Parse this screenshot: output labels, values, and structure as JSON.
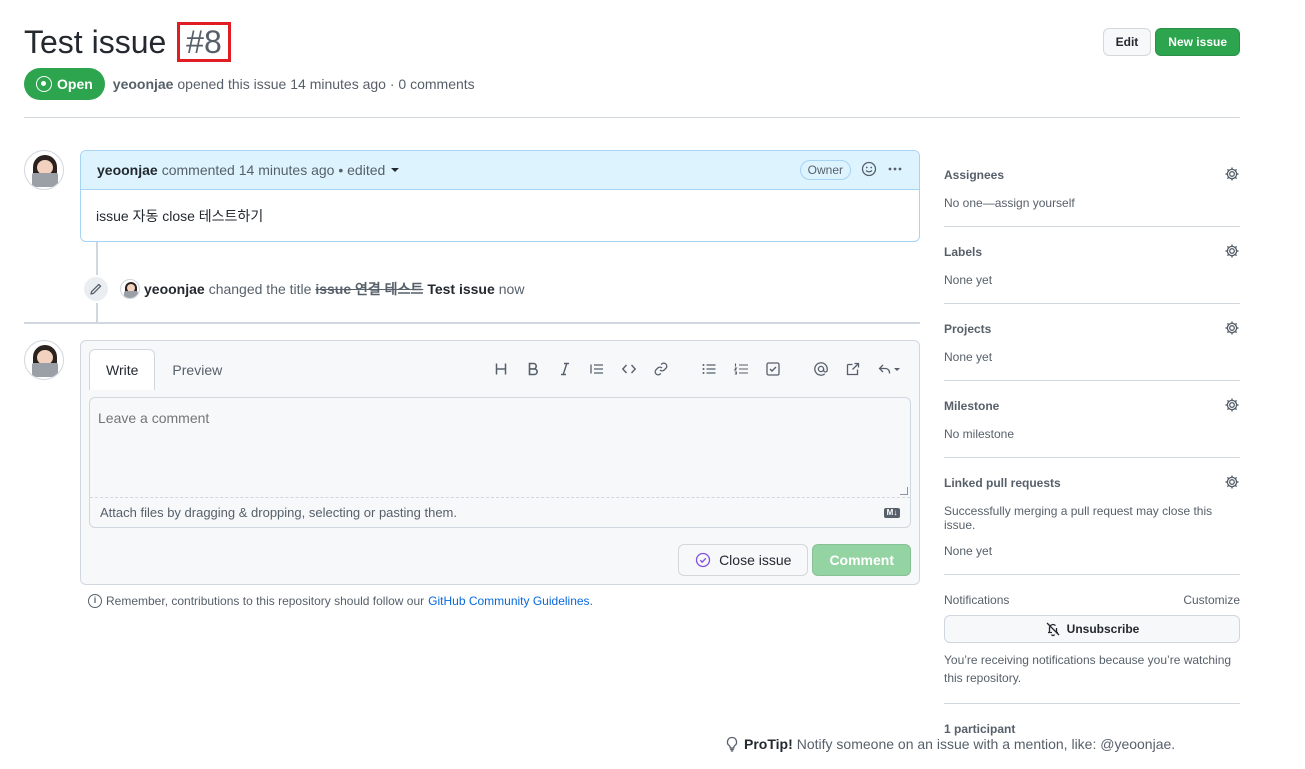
{
  "issue": {
    "title": "Test issue",
    "number": "#8",
    "state": "Open",
    "author": "yeoonjae",
    "meta_rest": "opened this issue 14 minutes ago · 0 comments"
  },
  "header_buttons": {
    "edit": "Edit",
    "new_issue": "New issue"
  },
  "comment": {
    "author": "yeoonjae",
    "meta": "commented 14 minutes ago • edited",
    "role": "Owner",
    "body": "issue 자동 close 테스트하기"
  },
  "event": {
    "actor": "yeoonjae",
    "action": "changed the title",
    "old_title": "issue 연결 테스트",
    "new_title": "Test issue",
    "time": "now"
  },
  "composer": {
    "tab_write": "Write",
    "tab_preview": "Preview",
    "placeholder": "Leave a comment",
    "attach_text": "Attach files by dragging & dropping, selecting or pasting them.",
    "md_badge": "M↓",
    "close_issue": "Close issue",
    "comment_button": "Comment",
    "toolbar_icons": [
      "heading-icon",
      "bold-icon",
      "italic-icon",
      "quote-icon",
      "code-icon",
      "link-icon",
      "bulleted-list-icon",
      "numbered-list-icon",
      "task-list-icon",
      "mention-icon",
      "cross-reference-icon",
      "reply-icon"
    ]
  },
  "guideline": {
    "text": "Remember, contributions to this repository should follow our",
    "link": "GitHub Community Guidelines",
    "end": "."
  },
  "sidebar": {
    "assignees": {
      "title": "Assignees",
      "value": "No one—assign yourself"
    },
    "labels": {
      "title": "Labels",
      "value": "None yet"
    },
    "projects": {
      "title": "Projects",
      "value": "None yet"
    },
    "milestone": {
      "title": "Milestone",
      "value": "No milestone"
    },
    "linked_prs": {
      "title": "Linked pull requests",
      "note": "Successfully merging a pull request may close this issue.",
      "value": "None yet"
    },
    "notifications": {
      "title": "Notifications",
      "customize": "Customize",
      "unsubscribe": "Unsubscribe",
      "note": "You’re receiving notifications because you’re watching this repository."
    },
    "participants": {
      "title": "1 participant"
    }
  },
  "protip": {
    "label": "ProTip!",
    "text": "Notify someone on an issue with a mention, like: @yeoonjae."
  },
  "colors": {
    "green": "#2da44e",
    "blue_link": "#0969da",
    "highlight_red": "#e11d24",
    "comment_head_bg": "#ddf4ff"
  }
}
